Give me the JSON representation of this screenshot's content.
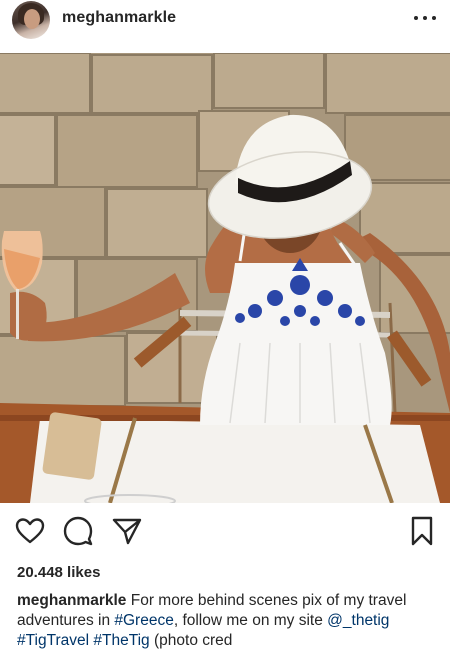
{
  "post": {
    "username": "meghanmarkle",
    "likes": "20.448 likes",
    "caption_username": "meghanmarkle",
    "caption_text_1": " For more behind scenes pix of my travel adventures in ",
    "hashtag_greece": "#Greece",
    "caption_text_2": ", follow me on my site ",
    "mention_thetig": "@_thetig",
    "hashtag_tigtravel": "#TigTravel",
    "hashtag_thetig": "#TheTig",
    "caption_text_3": " (photo cred"
  },
  "icons": {
    "more": "more-options-icon",
    "like": "heart-icon",
    "comment": "comment-icon",
    "share": "share-icon",
    "save": "bookmark-icon"
  },
  "colors": {
    "text": "#262626",
    "link": "#003569",
    "background": "#ffffff"
  }
}
